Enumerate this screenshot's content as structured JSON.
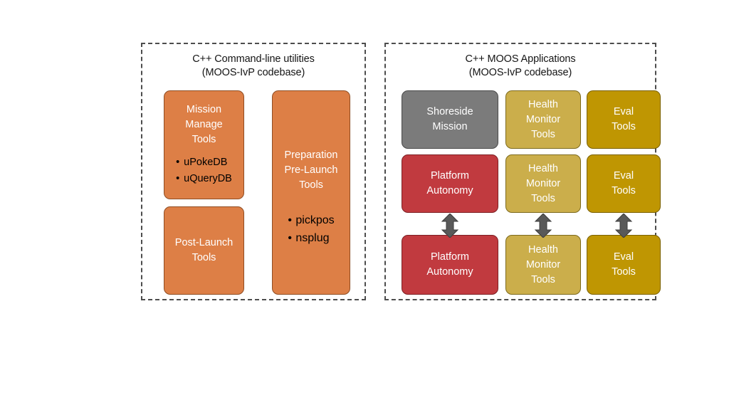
{
  "diagram": {
    "background": "#ffffff",
    "panels": [
      {
        "id": "left",
        "title": "C++ Command-line utilities\n(MOOS-IvP codebase)",
        "nodes": [
          {
            "id": "mission-manage",
            "label": "Mission\nManage\nTools",
            "color": "#DD7F46",
            "bullets": [
              "uPokeDB",
              "uQueryDB"
            ]
          },
          {
            "id": "post-launch",
            "label": "Post-Launch\nTools",
            "color": "#DD7F46",
            "bullets": []
          },
          {
            "id": "preparation",
            "label": "Preparation\nPre-Launch\nTools",
            "color": "#DD7F46",
            "bullets": [
              "pickpos",
              "nsplug"
            ]
          }
        ]
      },
      {
        "id": "right",
        "title": "C++ MOOS Applications\n(MOOS-IvP codebase)",
        "nodes": [
          {
            "id": "shoreside",
            "label": "Shoreside\nMission",
            "color": "#7B7B7B"
          },
          {
            "id": "health-1",
            "label": "Health\nMonitor\nTools",
            "color": "#CBAE4B"
          },
          {
            "id": "eval-1",
            "label": "Eval\nTools",
            "color": "#BF9602"
          },
          {
            "id": "platform-1",
            "label": "Platform\nAutonomy",
            "color": "#C13A3F"
          },
          {
            "id": "health-2",
            "label": "Health\nMonitor\nTools",
            "color": "#CBAE4B"
          },
          {
            "id": "eval-2",
            "label": "Eval\nTools",
            "color": "#BF9602"
          },
          {
            "id": "platform-2",
            "label": "Platform\nAutonomy",
            "color": "#C13A3F"
          },
          {
            "id": "health-3",
            "label": "Health\nMonitor\nTools",
            "color": "#CBAE4B"
          },
          {
            "id": "eval-3",
            "label": "Eval\nTools",
            "color": "#BF9602"
          }
        ],
        "connectors": [
          {
            "id": "platform",
            "type": "double-arrow-vertical",
            "color": "#595959",
            "from": "platform-1",
            "to": "platform-2"
          },
          {
            "id": "health",
            "type": "double-arrow-vertical",
            "color": "#595959",
            "from": "health-2",
            "to": "health-3"
          },
          {
            "id": "eval",
            "type": "double-arrow-vertical",
            "color": "#595959",
            "from": "eval-2",
            "to": "eval-3"
          }
        ]
      }
    ]
  }
}
